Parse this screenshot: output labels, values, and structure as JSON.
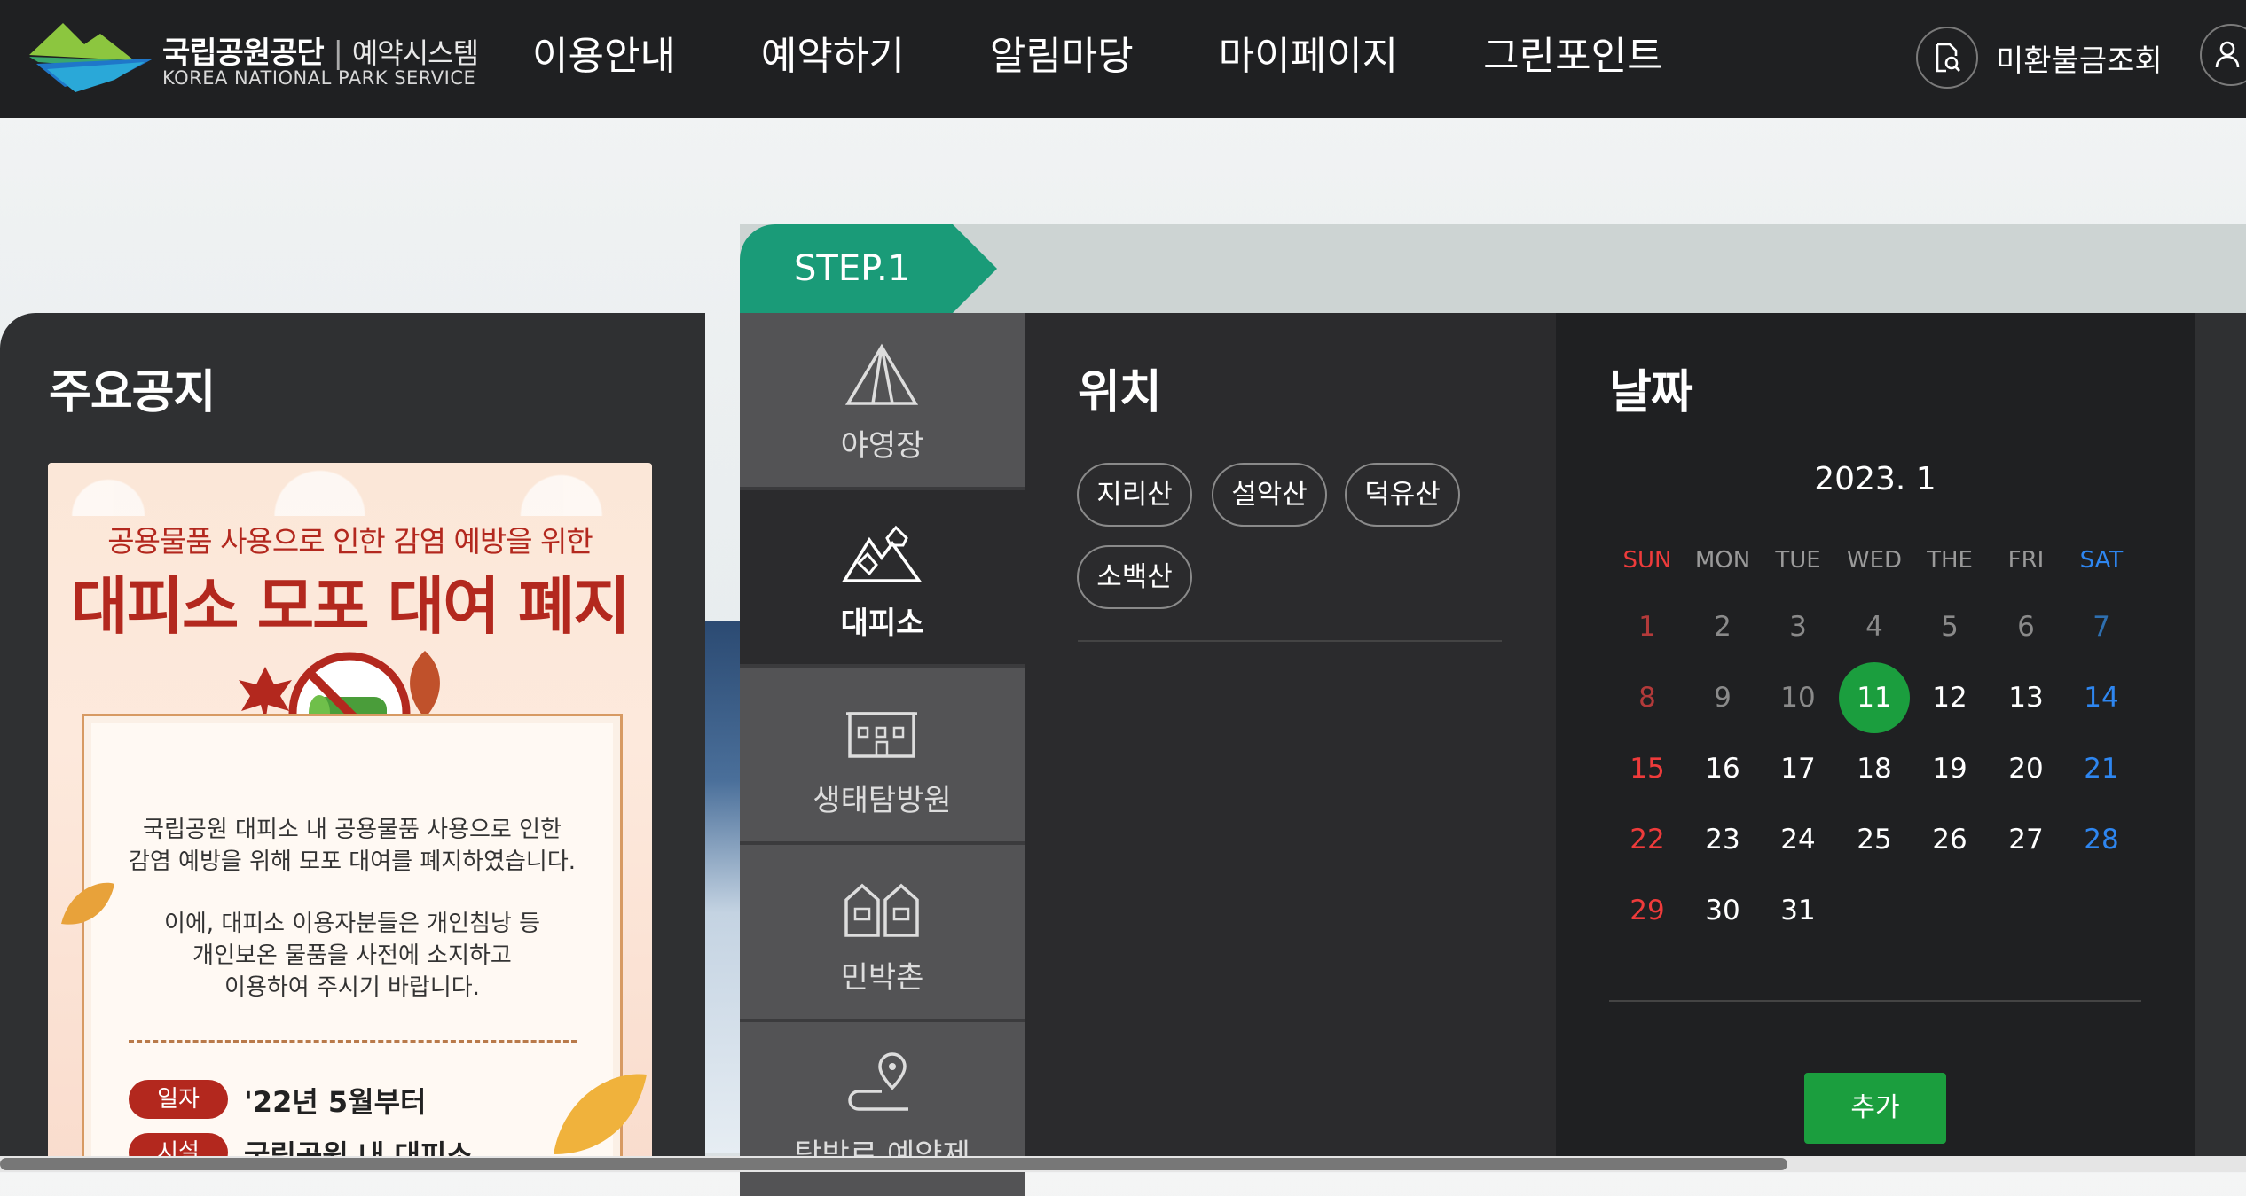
{
  "header": {
    "logo_kr": "국립공원공단",
    "logo_sub": "예약시스템",
    "logo_en": "KOREA NATIONAL PARK SERVICE",
    "nav": [
      "이용안내",
      "예약하기",
      "알림마당",
      "마이페이지",
      "그린포인트"
    ],
    "refund_label": "미환불금조회"
  },
  "notice": {
    "title": "주요공지",
    "poster": {
      "top": "공용물품 사용으로 인한 감염 예방을 위한",
      "headline": "대피소 모포 대여 폐지",
      "p1_l1": "국립공원 대피소 내 공용물품 사용으로 인한",
      "p1_l2": "감염 예방을 위해 모포 대여를 폐지하였습니다.",
      "p2_l1": "이에, 대피소 이용자분들은 개인침낭 등",
      "p2_l2": "개인보온 물품을 사전에 소지하고",
      "p2_l3": "이용하여 주시기 바랍니다.",
      "tag1": "일자",
      "tag1_value": "'22년 5월부터",
      "tag2": "시설",
      "tag2_value": "국립공원 내 대피소"
    }
  },
  "step": {
    "label": "STEP.1",
    "types": [
      "야영장",
      "대피소",
      "생태탐방원",
      "민박촌",
      "탐방로 예약제"
    ],
    "active_type": "대피소"
  },
  "location": {
    "title": "위치",
    "chips": [
      "지리산",
      "설악산",
      "덕유산",
      "소백산"
    ]
  },
  "date": {
    "title": "날짜",
    "month": "2023. 1",
    "weekdays": [
      "SUN",
      "MON",
      "TUE",
      "WED",
      "THE",
      "FRI",
      "SAT"
    ],
    "days": [
      "1",
      "2",
      "3",
      "4",
      "5",
      "6",
      "7",
      "8",
      "9",
      "10",
      "11",
      "12",
      "13",
      "14",
      "15",
      "16",
      "17",
      "18",
      "19",
      "20",
      "21",
      "22",
      "23",
      "24",
      "25",
      "26",
      "27",
      "28",
      "29",
      "30",
      "31"
    ],
    "selected_day": "11",
    "add_label": "추가"
  },
  "colors": {
    "accent_green": "#1b9e3e",
    "step_teal": "#1a9b78",
    "sunday_red": "#ee3b3b",
    "saturday_blue": "#2e86f0"
  }
}
